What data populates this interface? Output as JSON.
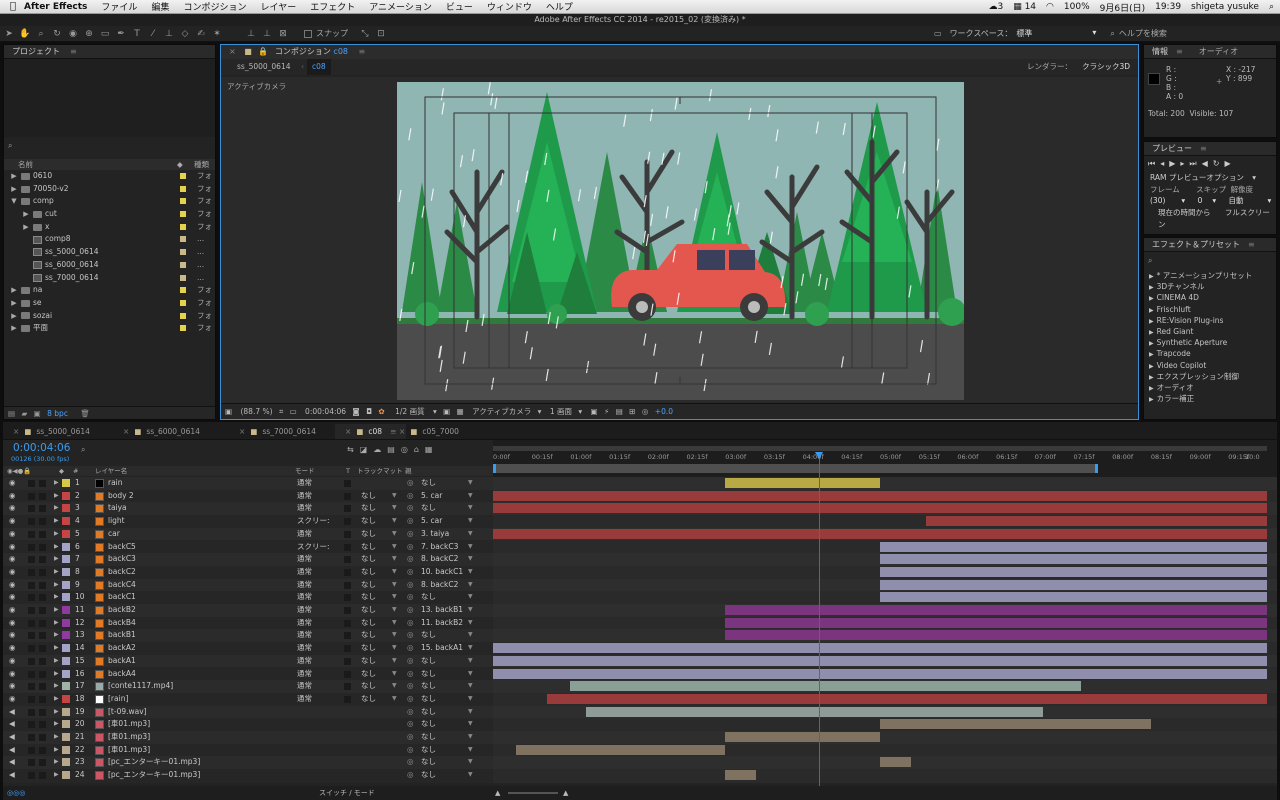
{
  "menubar": {
    "apple": "",
    "app": "After Effects",
    "items": [
      "ファイル",
      "編集",
      "コンポジション",
      "レイヤー",
      "エフェクト",
      "アニメーション",
      "ビュー",
      "ウィンドウ",
      "ヘルプ"
    ],
    "right": {
      "badge": "3",
      "number": "14",
      "battery": "100%",
      "date": "9月6日(日)",
      "time": "19:39",
      "user": "shigeta yusuke"
    }
  },
  "window_title": "Adobe After Effects CC 2014 - re2015_02 (変換済み) *",
  "toolbar": {
    "snap": "スナップ",
    "workspace_label": "ワークスペース：",
    "workspace_value": "標準",
    "help_placeholder": "ヘルプを検索"
  },
  "project": {
    "title": "プロジェクト",
    "col_name": "名前",
    "col_type": "種類",
    "bpc": "8 bpc",
    "items": [
      {
        "name": "0610",
        "type": "フォ",
        "kind": "folder",
        "indent": 0,
        "open": false,
        "color": "#e3d24a"
      },
      {
        "name": "70050-v2",
        "type": "フォ",
        "kind": "folder",
        "indent": 0,
        "open": false,
        "color": "#e3d24a"
      },
      {
        "name": "comp",
        "type": "フォ",
        "kind": "folder",
        "indent": 0,
        "open": true,
        "color": "#e3d24a"
      },
      {
        "name": "cut",
        "type": "フォ",
        "kind": "folder",
        "indent": 1,
        "open": false,
        "color": "#e3d24a"
      },
      {
        "name": "x",
        "type": "フォ",
        "kind": "folder",
        "indent": 1,
        "open": false,
        "color": "#e3d24a"
      },
      {
        "name": "comp8",
        "type": "...",
        "kind": "comp",
        "indent": 1,
        "color": "#c9b88a"
      },
      {
        "name": "ss_5000_0614",
        "type": "...",
        "kind": "comp",
        "indent": 1,
        "color": "#c9b88a"
      },
      {
        "name": "ss_6000_0614",
        "type": "...",
        "kind": "comp",
        "indent": 1,
        "color": "#c9b88a"
      },
      {
        "name": "ss_7000_0614",
        "type": "...",
        "kind": "comp",
        "indent": 1,
        "color": "#c9b88a"
      },
      {
        "name": "na",
        "type": "フォ",
        "kind": "folder",
        "indent": 0,
        "open": false,
        "color": "#e3d24a"
      },
      {
        "name": "se",
        "type": "フォ",
        "kind": "folder",
        "indent": 0,
        "open": false,
        "color": "#e3d24a"
      },
      {
        "name": "sozai",
        "type": "フォ",
        "kind": "folder",
        "indent": 0,
        "open": false,
        "color": "#e3d24a"
      },
      {
        "name": "平面",
        "type": "フォ",
        "kind": "folder",
        "indent": 0,
        "open": false,
        "color": "#e3d24a"
      }
    ]
  },
  "viewer": {
    "tab_label": "コンポジション",
    "tab_comp": "c08",
    "crumb1": "ss_5000_0614",
    "crumb2": "c08",
    "renderer_label": "レンダラー：",
    "renderer_value": "クラシック3D",
    "camera_label": "アクティブカメラ",
    "zoom": "(88.7 %)",
    "timecode": "0:00:04:06",
    "resolution": "1/2 画質",
    "camera": "アクティブカメラ",
    "views": "1 画面",
    "exposure": "+0.0"
  },
  "info": {
    "tab1": "情報",
    "tab2": "オーディオ",
    "r": "R :",
    "g": "G :",
    "b": "B :",
    "a": "A : 0",
    "x": "X : -217",
    "y": "Y : 899",
    "total": "Total: 200",
    "visible": "Visible: 107"
  },
  "preview": {
    "title": "プレビュー",
    "ram": "RAM プレビューオプション",
    "frame_label": "フレーム",
    "skip_label": "スキップ",
    "res_label": "解像度",
    "frame_val": "(30)",
    "skip_val": "0",
    "res_val": "自動",
    "from_current": "現在の時間から",
    "fullscreen": "フルスクリーン"
  },
  "effects": {
    "title": "エフェクト＆プリセット",
    "items": [
      "* アニメーションプリセット",
      "3Dチャンネル",
      "CINEMA 4D",
      "Frischluft",
      "RE:Vision Plug-ins",
      "Red Giant",
      "Synthetic Aperture",
      "Trapcode",
      "Video Copilot",
      "エクスプレッション制御",
      "オーディオ",
      "カラー補正"
    ]
  },
  "timeline": {
    "tabs": [
      "ss_5000_0614",
      "ss_6000_0614",
      "ss_7000_0614",
      "c08",
      "c05_7000"
    ],
    "active_tab": 3,
    "timecode": "0:00:04:06",
    "timecode_sub": "00126 (30.00 fps)",
    "col_layer": "レイヤー名",
    "col_mode": "モード",
    "col_t": "T",
    "col_trkmat": "トラックマット",
    "col_parent": "親",
    "ruler": [
      "0:00f",
      "00:15f",
      "01:00f",
      "01:15f",
      "02:00f",
      "02:15f",
      "03:00f",
      "03:15f",
      "04:00f",
      "04:15f",
      "05:00f",
      "05:15f",
      "06:00f",
      "06:15f",
      "07:00f",
      "07:15f",
      "08:00f",
      "08:15f",
      "09:00f",
      "09:15f",
      "10:0"
    ],
    "footer": "スイッチ / モード",
    "layers": [
      {
        "n": "1",
        "name": "rain",
        "mode": "通常",
        "trk": "",
        "parent": "なし",
        "color": "#d6c94a",
        "bar": "#b8a944",
        "s": 0.3,
        "e": 0.5,
        "icon": "black"
      },
      {
        "n": "2",
        "name": "body 2",
        "mode": "通常",
        "trk": "なし",
        "parent": "5. car",
        "color": "#c54545",
        "bar": "#9a3b3b",
        "s": 0.0,
        "e": 1.0,
        "icon": "ai"
      },
      {
        "n": "3",
        "name": "taiya",
        "mode": "通常",
        "trk": "なし",
        "parent": "なし",
        "color": "#c54545",
        "bar": "#9a3b3b",
        "s": 0.0,
        "e": 1.0,
        "icon": "ai"
      },
      {
        "n": "4",
        "name": "light",
        "mode": "スクリー:",
        "trk": "なし",
        "parent": "5. car",
        "color": "#c54545",
        "bar": "#9a3b3b",
        "s": 0.56,
        "e": 1.0,
        "icon": "ai"
      },
      {
        "n": "5",
        "name": "car",
        "mode": "通常",
        "trk": "なし",
        "parent": "3. taiya",
        "color": "#c54545",
        "bar": "#9a3b3b",
        "s": 0.0,
        "e": 1.0,
        "icon": "ai"
      },
      {
        "n": "6",
        "name": "backC5",
        "mode": "スクリー:",
        "trk": "なし",
        "parent": "7. backC3",
        "color": "#a3a3c8",
        "bar": "#8f8fad",
        "s": 0.5,
        "e": 1.0,
        "icon": "ai"
      },
      {
        "n": "7",
        "name": "backC3",
        "mode": "通常",
        "trk": "なし",
        "parent": "8. backC2",
        "color": "#a3a3c8",
        "bar": "#8f8fad",
        "s": 0.5,
        "e": 1.0,
        "icon": "ai"
      },
      {
        "n": "8",
        "name": "backC2",
        "mode": "通常",
        "trk": "なし",
        "parent": "10. backC1",
        "color": "#a3a3c8",
        "bar": "#8f8fad",
        "s": 0.5,
        "e": 1.0,
        "icon": "ai"
      },
      {
        "n": "9",
        "name": "backC4",
        "mode": "通常",
        "trk": "なし",
        "parent": "8. backC2",
        "color": "#a3a3c8",
        "bar": "#8f8fad",
        "s": 0.5,
        "e": 1.0,
        "icon": "ai"
      },
      {
        "n": "10",
        "name": "backC1",
        "mode": "通常",
        "trk": "なし",
        "parent": "なし",
        "color": "#a3a3c8",
        "bar": "#8f8fad",
        "s": 0.5,
        "e": 1.0,
        "icon": "ai"
      },
      {
        "n": "11",
        "name": "backB2",
        "mode": "通常",
        "trk": "なし",
        "parent": "13. backB1",
        "color": "#8e3a9e",
        "bar": "#7b357f",
        "s": 0.3,
        "e": 1.0,
        "icon": "ai"
      },
      {
        "n": "12",
        "name": "backB4",
        "mode": "通常",
        "trk": "なし",
        "parent": "11. backB2",
        "color": "#8e3a9e",
        "bar": "#7b357f",
        "s": 0.3,
        "e": 1.0,
        "icon": "ai"
      },
      {
        "n": "13",
        "name": "backB1",
        "mode": "通常",
        "trk": "なし",
        "parent": "なし",
        "color": "#8e3a9e",
        "bar": "#7b357f",
        "s": 0.3,
        "e": 1.0,
        "icon": "ai"
      },
      {
        "n": "14",
        "name": "backA2",
        "mode": "通常",
        "trk": "なし",
        "parent": "15. backA1",
        "color": "#a3a3c8",
        "bar": "#8f8fad",
        "s": 0.0,
        "e": 1.0,
        "icon": "ai"
      },
      {
        "n": "15",
        "name": "backA1",
        "mode": "通常",
        "trk": "なし",
        "parent": "なし",
        "color": "#a3a3c8",
        "bar": "#8f8fad",
        "s": 0.0,
        "e": 1.0,
        "icon": "ai"
      },
      {
        "n": "16",
        "name": "backA4",
        "mode": "通常",
        "trk": "なし",
        "parent": "なし",
        "color": "#a3a3c8",
        "bar": "#8f8fad",
        "s": 0.0,
        "e": 1.0,
        "icon": "ai"
      },
      {
        "n": "17",
        "name": "[conte1117.mp4]",
        "mode": "通常",
        "trk": "なし",
        "parent": "なし",
        "color": "#9fb3a8",
        "bar": "#8aa097",
        "s": 0.1,
        "e": 0.76,
        "icon": "mov"
      },
      {
        "n": "18",
        "name": "[rain]",
        "mode": "通常",
        "trk": "なし",
        "parent": "なし",
        "color": "#c54545",
        "bar": "#9a3b3b",
        "s": 0.07,
        "e": 1.0,
        "icon": "white"
      },
      {
        "n": "19",
        "name": "[t-09.wav]",
        "mode": "",
        "trk": "",
        "parent": "なし",
        "color": "#b5a88d",
        "bar": "#8f9b97",
        "s": 0.12,
        "e": 0.71,
        "icon": "aud"
      },
      {
        "n": "20",
        "name": "[車01.mp3]",
        "mode": "",
        "trk": "",
        "parent": "なし",
        "color": "#b5a88d",
        "bar": "#7f7261",
        "s": 0.5,
        "e": 0.85,
        "icon": "aud"
      },
      {
        "n": "21",
        "name": "[車01.mp3]",
        "mode": "",
        "trk": "",
        "parent": "なし",
        "color": "#b5a88d",
        "bar": "#7f7261",
        "s": 0.3,
        "e": 0.5,
        "icon": "aud"
      },
      {
        "n": "22",
        "name": "[車01.mp3]",
        "mode": "",
        "trk": "",
        "parent": "なし",
        "color": "#b5a88d",
        "bar": "#7f7261",
        "s": 0.03,
        "e": 0.3,
        "icon": "aud"
      },
      {
        "n": "23",
        "name": "[pc_エンターキー01.mp3]",
        "mode": "",
        "trk": "",
        "parent": "なし",
        "color": "#b5a88d",
        "bar": "#7f7261",
        "s": 0.5,
        "e": 0.54,
        "icon": "aud"
      },
      {
        "n": "24",
        "name": "[pc_エンターキー01.mp3]",
        "mode": "",
        "trk": "",
        "parent": "なし",
        "color": "#b5a88d",
        "bar": "#7f7261",
        "s": 0.3,
        "e": 0.34,
        "icon": "aud"
      }
    ]
  }
}
